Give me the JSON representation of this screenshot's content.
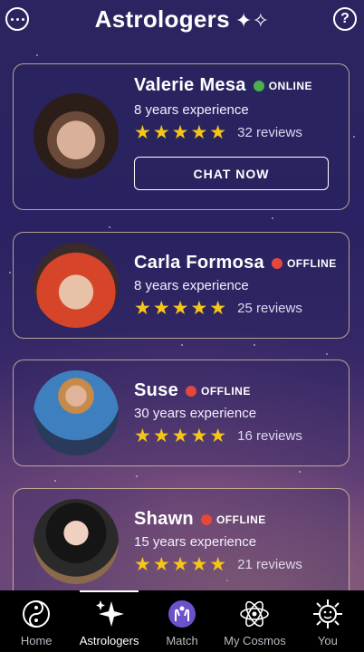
{
  "header": {
    "title": "Astrologers",
    "title_icon": "sparkles-icon",
    "left_icon": "chat-bubble-icon",
    "right_icon": "help-icon"
  },
  "astrologers": [
    {
      "name": "Valerie Mesa",
      "status": "ONLINE",
      "status_color": "#4caf50",
      "experience": "8 years experience",
      "rating": 5,
      "reviews": "32 reviews",
      "action": "CHAT NOW"
    },
    {
      "name": "Carla Formosa",
      "status": "OFFLINE",
      "status_color": "#e5473d",
      "experience": "8 years experience",
      "rating": 5,
      "reviews": "25 reviews"
    },
    {
      "name": "Suse",
      "status": "OFFLINE",
      "status_color": "#e5473d",
      "experience": "30 years experience",
      "rating": 5,
      "reviews": "16 reviews"
    },
    {
      "name": "Shawn",
      "status": "OFFLINE",
      "status_color": "#e5473d",
      "experience": "15 years experience",
      "rating": 5,
      "reviews": "21 reviews"
    }
  ],
  "stars_glyph": "★★★★★",
  "nav": {
    "items": [
      {
        "label": "Home",
        "icon": "yin-yang-icon"
      },
      {
        "label": "Astrologers",
        "icon": "sparkles-icon",
        "active": true
      },
      {
        "label": "Match",
        "icon": "hands-icon"
      },
      {
        "label": "My Cosmos",
        "icon": "atom-icon"
      },
      {
        "label": "You",
        "icon": "sun-face-icon"
      }
    ]
  },
  "colors": {
    "accent_gold": "#f5c518",
    "online": "#4caf50",
    "offline": "#e5473d"
  }
}
